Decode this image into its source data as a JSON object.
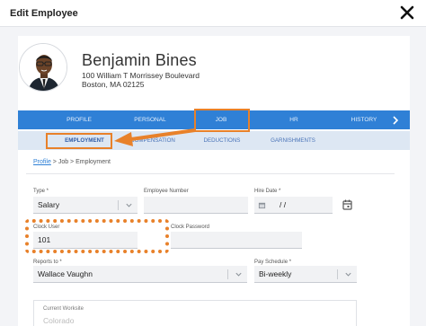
{
  "header": {
    "title": "Edit Employee"
  },
  "employee": {
    "name": "Benjamin Bines",
    "address_line1": "100 William T Morrissey Boulevard",
    "address_line2": "Boston, MA 02125"
  },
  "tabs": [
    {
      "label": "PROFILE"
    },
    {
      "label": "PERSONAL"
    },
    {
      "label": "JOB"
    },
    {
      "label": "HR"
    },
    {
      "label": "HISTORY"
    }
  ],
  "subtabs": [
    {
      "label": "EMPLOYMENT"
    },
    {
      "label": "COMPENSATION"
    },
    {
      "label": "DEDUCTIONS"
    },
    {
      "label": "GARNISHMENTS"
    }
  ],
  "breadcrumb": {
    "link": "Profile",
    "rest": " > Job > Employment"
  },
  "form": {
    "type": {
      "label": "Type *",
      "value": "Salary"
    },
    "employee_number": {
      "label": "Employee Number",
      "value": ""
    },
    "hire_date": {
      "label": "Hire Date *",
      "value": "/ /"
    },
    "clock_user": {
      "label": "Clock User",
      "value": "101"
    },
    "clock_password": {
      "label": "Clock Password",
      "value": ""
    },
    "reports_to": {
      "label": "Reports to *",
      "value": "Wallace Vaughn"
    },
    "pay_schedule": {
      "label": "Pay Schedule *",
      "value": "Bi-weekly"
    },
    "current_worksite": {
      "label": "Current Worksite",
      "value": "Colorado"
    }
  },
  "colors": {
    "tab_bar": "#2f80d6",
    "subtab_bar": "#dde7f3",
    "annotation": "#e8812a"
  },
  "icons": [
    "close-icon",
    "chevron-right-icon",
    "chevron-down-icon",
    "calendar-icon"
  ]
}
